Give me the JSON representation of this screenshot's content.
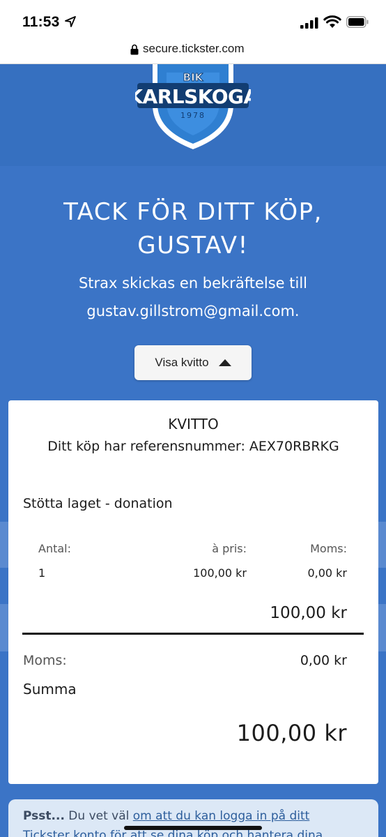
{
  "status_bar": {
    "time": "11:53",
    "icons": [
      "location-arrow-icon",
      "cellular-signal-icon",
      "wifi-icon",
      "battery-icon"
    ]
  },
  "browser": {
    "url": "secure.tickster.com",
    "lock_icon": "lock-icon"
  },
  "logo": {
    "top_text": "BIK",
    "name": "KARLSKOGA",
    "year": "1978"
  },
  "hero": {
    "headline_line1": "TACK FÖR DITT KÖP,",
    "headline_line2": "GUSTAV!",
    "subtitle_line1": "Strax skickas en bekräftelse till",
    "subtitle_line2": "gustav.gillstrom@gmail.com."
  },
  "receipt_toggle": {
    "label": "Visa kvitto",
    "icon": "caret-up-icon"
  },
  "receipt": {
    "title": "KVITTO",
    "reference": "Ditt köp har referensnummer: AEX70RBRKG",
    "item_name": "Stötta laget - donation",
    "columns": {
      "quantity": "Antal:",
      "unit_price": "à pris:",
      "vat": "Moms:"
    },
    "row": {
      "quantity": "1",
      "unit_price": "100,00 kr",
      "vat": "0,00 kr"
    },
    "line_total": "100,00 kr",
    "vat_label": "Moms:",
    "vat_total": "0,00 kr",
    "sum_label": "Summa",
    "sum_total": "100,00 kr"
  },
  "psst": {
    "bold": "Psst...",
    "text_before": " Du vet väl ",
    "link1": "om att du kan logga in på ditt",
    "line2_link": "Tickster konto för att se dina köp och hantera dina"
  },
  "colors": {
    "hero_blue": "#3b74c6",
    "logo_blue": "#2f7fd1",
    "card_bg": "#ffffff",
    "psst_bg": "#dce8f6"
  }
}
